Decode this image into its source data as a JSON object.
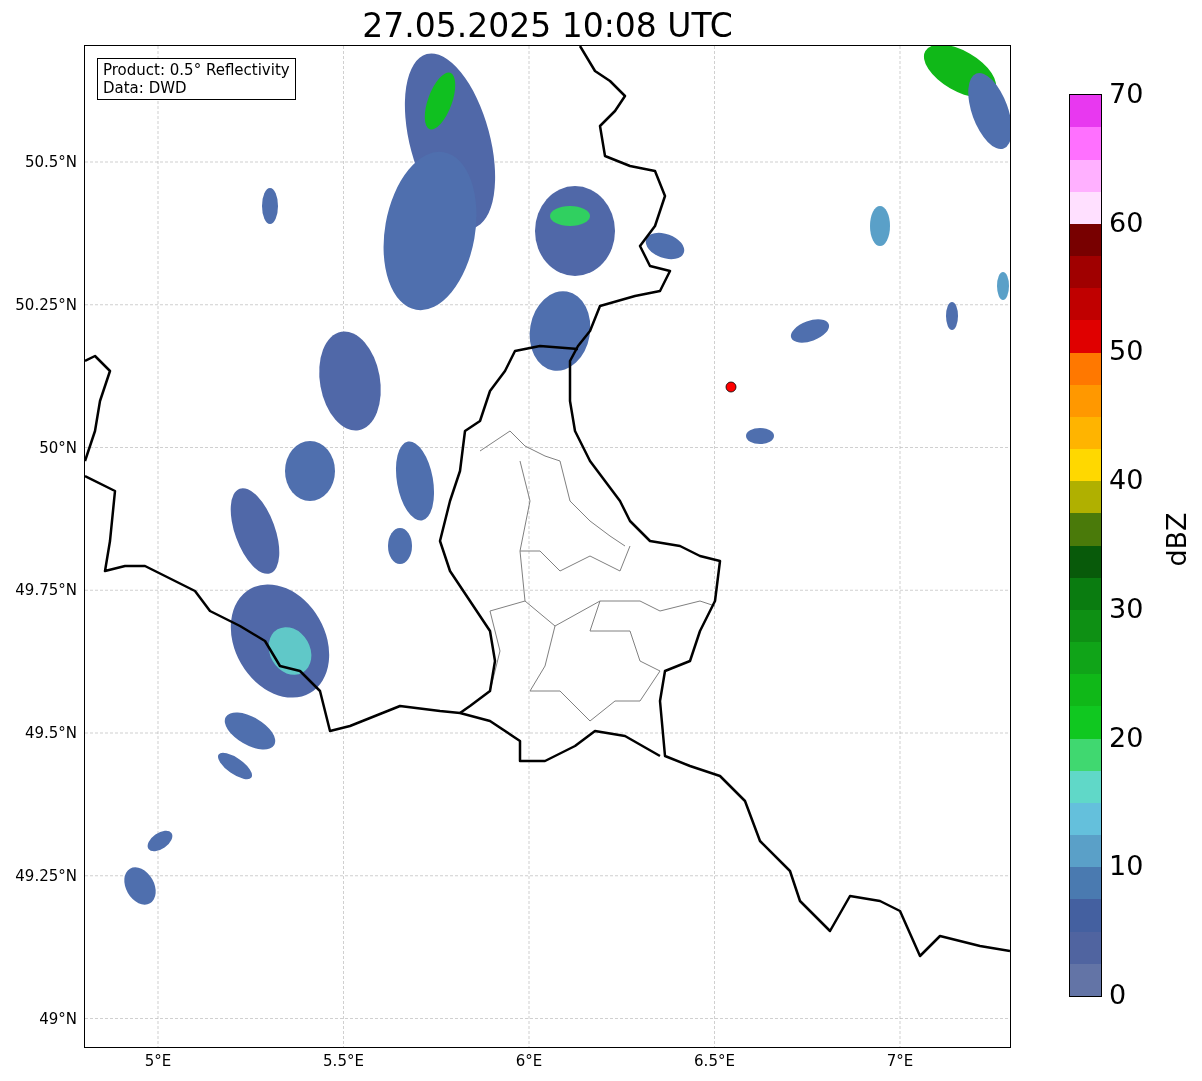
{
  "title": "27.05.2025 10:08 UTC",
  "info_box": {
    "lines": [
      "Product: 0.5° Reflectivity",
      "Data: DWD"
    ]
  },
  "map": {
    "lat_labels": [
      "50.5°N",
      "50.25°N",
      "50°N",
      "49.75°N",
      "49.5°N",
      "49.25°N",
      "49°N"
    ],
    "lon_labels": [
      "5°E",
      "5.5°E",
      "6°E",
      "6.5°E",
      "7°E"
    ]
  },
  "colorbar": {
    "label": "dBZ",
    "ticks": [
      "70",
      "60",
      "50",
      "40",
      "30",
      "20",
      "10",
      "0"
    ],
    "segments": [
      {
        "color": "#6374a6"
      },
      {
        "color": "#5064a0"
      },
      {
        "color": "#4460a0"
      },
      {
        "color": "#4a7ab0"
      },
      {
        "color": "#5aa0c8"
      },
      {
        "color": "#64c0dc"
      },
      {
        "color": "#60d8c8"
      },
      {
        "color": "#40d870"
      },
      {
        "color": "#10c820"
      },
      {
        "color": "#10b818"
      },
      {
        "color": "#10a418"
      },
      {
        "color": "#0e9014"
      },
      {
        "color": "#0a7c10"
      },
      {
        "color": "#085a0a"
      },
      {
        "color": "#4a7a0a"
      },
      {
        "color": "#b0b000"
      },
      {
        "color": "#ffd800"
      },
      {
        "color": "#ffb400"
      },
      {
        "color": "#ff9800"
      },
      {
        "color": "#ff7800"
      },
      {
        "color": "#e00000"
      },
      {
        "color": "#c00000"
      },
      {
        "color": "#a00000"
      },
      {
        "color": "#780000"
      },
      {
        "color": "#ffe0ff"
      },
      {
        "color": "#ffb0ff"
      },
      {
        "color": "#ff70ff"
      },
      {
        "color": "#e838f0"
      }
    ]
  }
}
